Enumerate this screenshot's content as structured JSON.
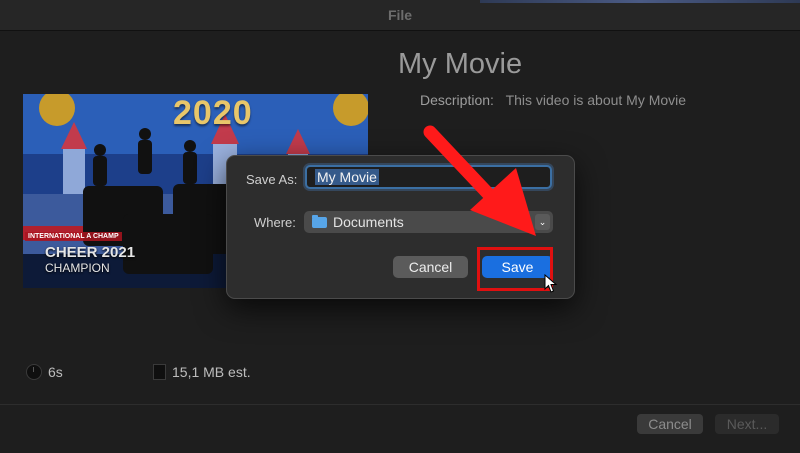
{
  "window": {
    "title": "File"
  },
  "project": {
    "title": "My Movie",
    "description_label": "Description:",
    "description_value": "This video is about My Movie"
  },
  "thumbnail": {
    "year": "2020",
    "banner": "INTERNATIONAL A CHAMP",
    "caption_line1": "CHEER 2021",
    "caption_line2": "CHAMPION"
  },
  "stats": {
    "duration": "6s",
    "size": "15,1 MB est."
  },
  "dialog": {
    "save_as_label": "Save As:",
    "save_as_value": "My Movie",
    "where_label": "Where:",
    "where_value": "Documents",
    "cancel_label": "Cancel",
    "save_label": "Save"
  },
  "footer": {
    "cancel_label": "Cancel",
    "next_label": "Next..."
  },
  "colors": {
    "accent_blue": "#1a6fe0",
    "highlight_red": "#e01010",
    "folder_blue": "#57a5e8"
  },
  "icons": [
    "clock-icon",
    "file-icon",
    "folder-icon",
    "chevron-down-icon",
    "arrow-annotation",
    "mouse-cursor-icon"
  ]
}
